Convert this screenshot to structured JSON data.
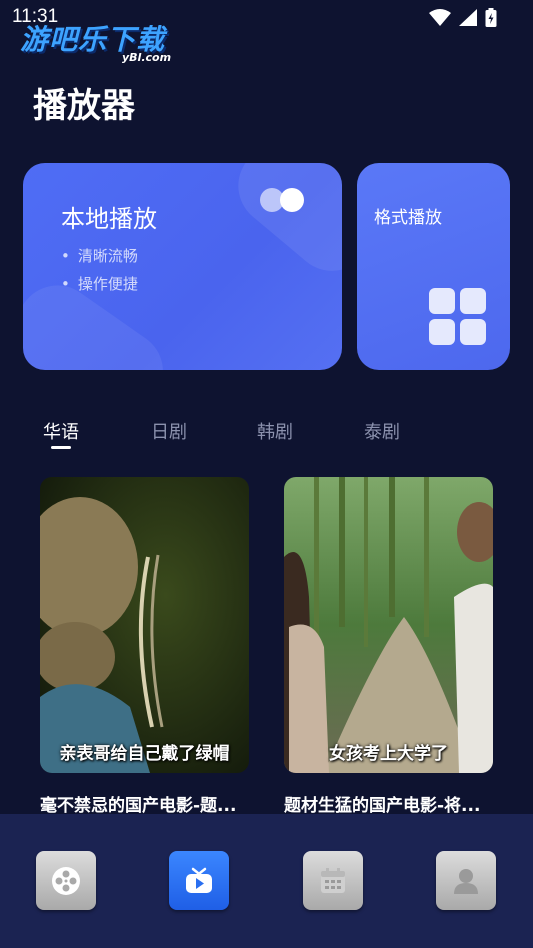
{
  "status_bar": {
    "time": "11:31"
  },
  "watermark": {
    "main": "游吧乐下载",
    "sub": "yBl.com"
  },
  "page": {
    "title": "播放器"
  },
  "cards": {
    "local": {
      "title": "本地播放",
      "bullets": [
        "清晰流畅",
        "操作便捷"
      ]
    },
    "format": {
      "title": "格式播放"
    }
  },
  "tabs": [
    {
      "label": "华语",
      "active": true
    },
    {
      "label": "日剧",
      "active": false
    },
    {
      "label": "韩剧",
      "active": false
    },
    {
      "label": "泰剧",
      "active": false
    }
  ],
  "videos": [
    {
      "caption": "亲表哥给自己戴了绿帽",
      "title": "毫不禁忌的国产电影-题..."
    },
    {
      "caption": "女孩考上大学了",
      "title": "题材生猛的国产电影-将..."
    }
  ],
  "bottom_nav": {
    "items": [
      {
        "icon": "film-reel-icon",
        "active": false
      },
      {
        "icon": "tv-play-icon",
        "active": true
      },
      {
        "icon": "calendar-icon",
        "active": false
      },
      {
        "icon": "profile-icon",
        "active": false
      }
    ]
  },
  "colors": {
    "background": "#0e1330",
    "card_blue": "#4f6df5",
    "nav_bg": "#1b2352",
    "nav_active": "#2a6ff0"
  }
}
